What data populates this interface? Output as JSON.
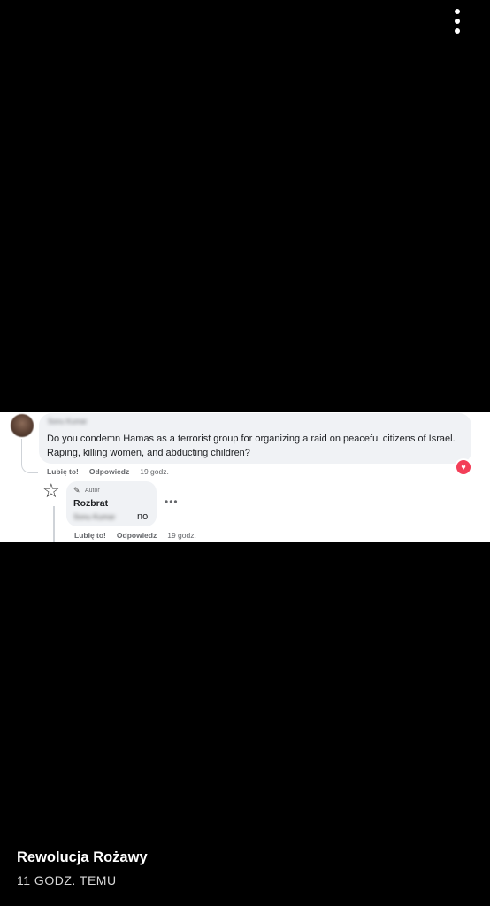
{
  "comment": {
    "author_blurred": "Sonu Kumar",
    "text": "Do you condemn Hamas as a terrorist group for organizing a raid on peaceful citizens of Israel. Raping, killing women, and abducting children?",
    "like_label": "Lubię to!",
    "reply_label": "Odpowiedz",
    "time": "19 godz."
  },
  "reply": {
    "badge": "Autor",
    "author": "Rozbrat",
    "mention_blurred": "Sonu Kumar",
    "text": "no",
    "more": "•••",
    "like_label": "Lubię to!",
    "reply_label": "Odpowiedz",
    "time": "19 godz."
  },
  "story": {
    "account_name": "Rewolucja Rożawy",
    "posted_time": "11 GODZ. TEMU"
  },
  "icons": {
    "menu": "more-vertical-icon",
    "heart": "heart-reaction-icon",
    "star": "star-icon",
    "pencil": "pencil-icon"
  },
  "colors": {
    "background": "#000000",
    "bubble": "#f0f2f5",
    "heart": "#f33e58"
  }
}
